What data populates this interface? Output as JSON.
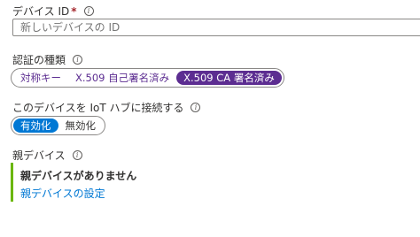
{
  "device_id": {
    "label": "デバイス ID",
    "required_mark": "*",
    "info_icon": "info-icon",
    "placeholder": "新しいデバイスの ID"
  },
  "auth_type": {
    "label": "認証の種類",
    "info_icon": "info-icon",
    "options": [
      "対称キー",
      "X.509 自己署名済み",
      "X.509 CA 署名済み"
    ],
    "selected": "X.509 CA 署名済み"
  },
  "connect": {
    "label": "このデバイスを IoT ハブに接続する",
    "info_icon": "info-icon",
    "options": [
      "有効化",
      "無効化"
    ],
    "selected": "有効化"
  },
  "parent_device": {
    "label": "親デバイス",
    "info_icon": "info-icon",
    "status": "親デバイスがありません",
    "link": "親デバイスの設定"
  },
  "colors": {
    "accent_purple": "#5c2d91",
    "accent_blue": "#0078d4",
    "success_green": "#6bb700"
  }
}
